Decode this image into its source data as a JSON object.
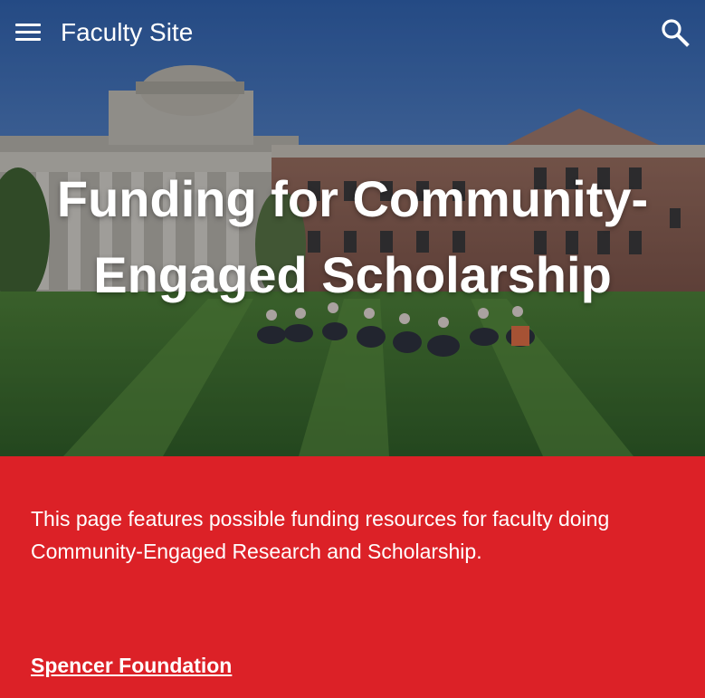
{
  "header": {
    "site_title": "Faculty Site",
    "menu_icon": "menu-icon",
    "search_icon": "search-icon"
  },
  "hero": {
    "title": "Funding for Community-Engaged Scholarship",
    "background_image": "campus building with students sitting on lawn"
  },
  "content": {
    "intro": "This page features possible funding resources for faculty doing Community-Engaged Research and Scholarship.",
    "links": [
      {
        "label": "Spencer Foundation"
      }
    ]
  },
  "colors": {
    "content_background": "#dc2127",
    "text": "#ffffff"
  }
}
